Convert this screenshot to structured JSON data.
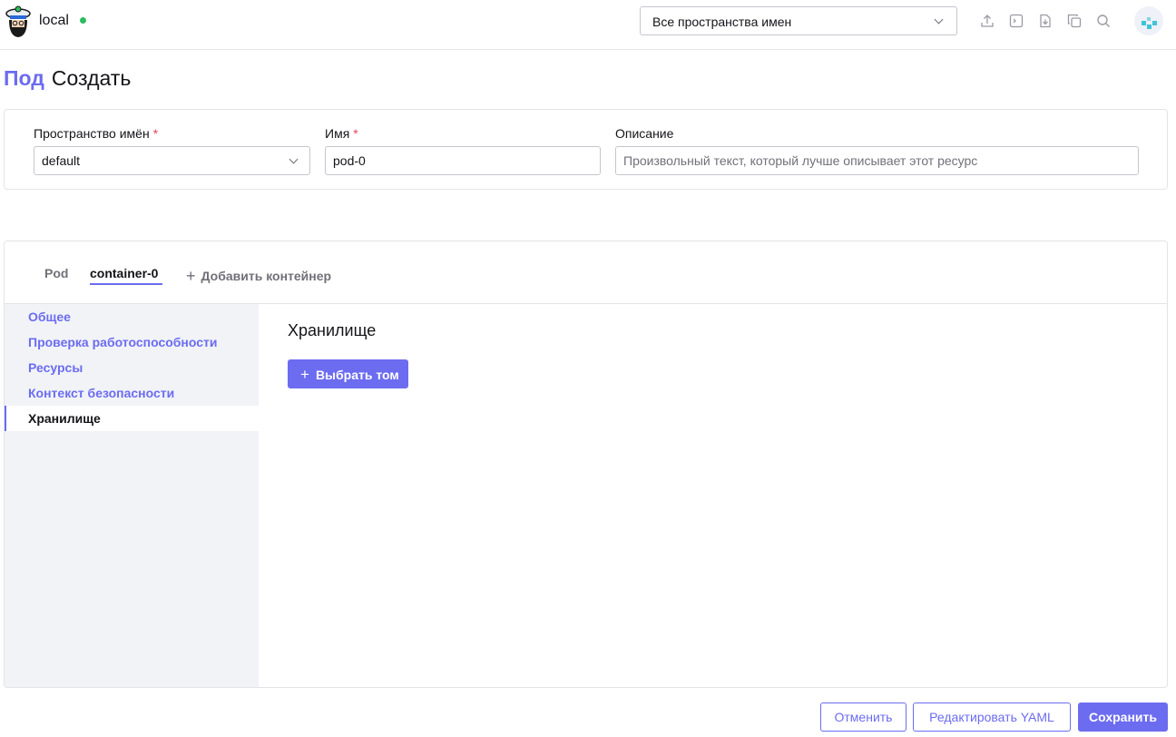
{
  "header": {
    "cluster_name": "local",
    "namespace_select": "Все пространства имен",
    "icons": [
      "upload-icon",
      "terminal-icon",
      "import-file-icon",
      "copy-icon",
      "search-icon"
    ]
  },
  "page": {
    "breadcrumb": "Под",
    "title": "Создать"
  },
  "form": {
    "namespace_label": "Пространство имён",
    "namespace_value": "default",
    "name_label": "Имя",
    "name_value": "pod-0",
    "description_label": "Описание",
    "description_placeholder": "Произвольный текст, который лучше описывает этот ресурс",
    "required_mark": "*"
  },
  "tabs": {
    "pod": "Pod",
    "container": "container-0",
    "add_container": "Добавить контейнер"
  },
  "sidebar": {
    "items": [
      {
        "label": "Общее"
      },
      {
        "label": "Проверка работоспособности"
      },
      {
        "label": "Ресурсы"
      },
      {
        "label": "Контекст безопасности"
      },
      {
        "label": "Хранилище"
      }
    ],
    "active": "Хранилище"
  },
  "content": {
    "section_title": "Хранилище",
    "select_volume_button": "Выбрать том"
  },
  "footer": {
    "cancel": "Отменить",
    "edit_yaml": "Редактировать YAML",
    "save": "Сохранить"
  },
  "colors": {
    "accent": "#6c6cf0",
    "status_online": "#2bbd5f",
    "required": "#e8415a",
    "sidebar_bg": "#f1f3f7"
  }
}
